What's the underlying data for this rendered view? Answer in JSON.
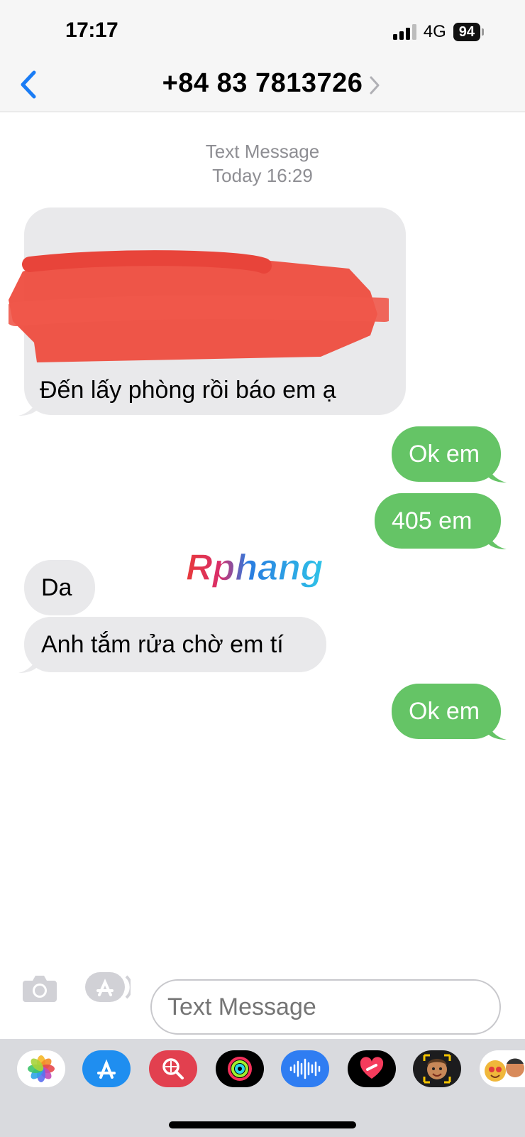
{
  "status_bar": {
    "time": "17:17",
    "network": "4G",
    "battery": "94"
  },
  "header": {
    "contact": "+84 83 7813726"
  },
  "thread": {
    "service": "Text Message",
    "date": "Today 16:29"
  },
  "messages": [
    {
      "side": "in",
      "text": "Đến lấy phòng rồi báo em ạ"
    },
    {
      "side": "out",
      "text": "Ok em"
    },
    {
      "side": "out",
      "text": "405 em"
    },
    {
      "side": "in",
      "text": "Da"
    },
    {
      "side": "in",
      "text": "Anh tắm rửa chờ em tí"
    },
    {
      "side": "out",
      "text": "Ok em"
    }
  ],
  "watermark": {
    "text": "Rphang"
  },
  "input": {
    "placeholder": "Text Message"
  },
  "colors": {
    "incoming": "#e9e9eb",
    "outgoing": "#65c466",
    "accent": "#1a7cf5",
    "redaction": "#ee4d3f"
  },
  "app_strip": [
    "photos-app-icon",
    "app-store-icon",
    "image-search-icon",
    "activity-icon",
    "audio-message-icon",
    "digital-touch-icon",
    "memoji-icon",
    "memoji-stickers-icon"
  ]
}
